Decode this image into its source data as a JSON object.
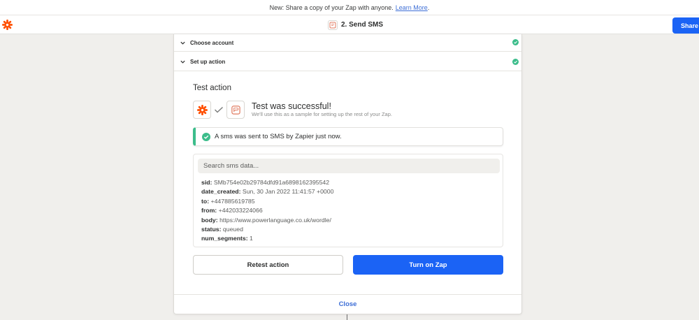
{
  "banner": {
    "text": "New: Share a copy of your Zap with anyone.",
    "link": "Learn More",
    "tail": "."
  },
  "header": {
    "step_title": "2. Send SMS",
    "share_label": "Share"
  },
  "accordion": [
    {
      "label": "Choose account",
      "status": "complete"
    },
    {
      "label": "Set up action",
      "status": "complete"
    }
  ],
  "test": {
    "title": "Test action",
    "success_title": "Test was successful!",
    "success_sub": "We'll use this as a sample for setting up the rest of your Zap.",
    "alert": "A sms was sent to SMS by Zapier just now."
  },
  "data": {
    "search_placeholder": "Search sms data...",
    "fields": [
      {
        "key": "sid:",
        "value": "SMb754e02b29784dfd91a6898162395542"
      },
      {
        "key": "date_created:",
        "value": "Sun, 30 Jan 2022 11:41:57 +0000"
      },
      {
        "key": "to:",
        "value": "+447885619785"
      },
      {
        "key": "from:",
        "value": "+442033224066"
      },
      {
        "key": "body:",
        "value": "https://www.powerlanguage.co.uk/wordle/"
      },
      {
        "key": "status:",
        "value": "queued"
      },
      {
        "key": "num_segments:",
        "value": "1"
      }
    ]
  },
  "actions": {
    "retest_label": "Retest action",
    "turn_on_label": "Turn on Zap"
  },
  "footer": {
    "close_label": "Close"
  },
  "colors": {
    "accent_blue": "#1b63f5",
    "link_blue": "#3d6ed6",
    "success_green": "#3cbd8b",
    "zapier_orange": "#ff4f00",
    "sms_icon": "#e07a5f",
    "background": "#f0efec"
  },
  "icons": {
    "logo": "zapier-asterisk-icon",
    "sms": "sms-app-icon",
    "chevron": "chevron-down-icon",
    "check": "check-circle-icon"
  }
}
